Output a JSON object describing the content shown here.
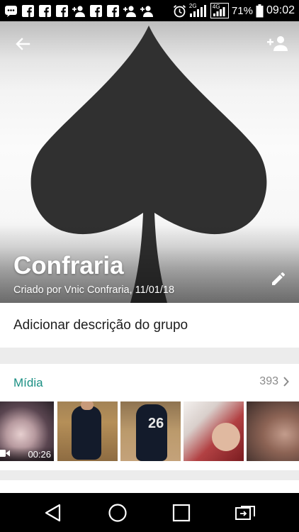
{
  "status_bar": {
    "notification_icons": [
      "whatsapp-icon",
      "facebook-icon",
      "facebook-icon",
      "facebook-icon",
      "add-contact-icon",
      "facebook-icon",
      "facebook-icon",
      "add-contact-icon",
      "add-contact-icon"
    ],
    "battery_percent": "71%",
    "time": "09:02",
    "network_labels": [
      "2G",
      "4G"
    ]
  },
  "header": {
    "group_name": "Confraria",
    "created_text": "Criado por Vnic Confraria, 11/01/18",
    "background_color": "#f4f4f4",
    "spade_color": "#303030"
  },
  "description": {
    "placeholder": "Adicionar descrição do grupo"
  },
  "media": {
    "title": "Mídia",
    "count": "393",
    "accent_color": "#1a8f83",
    "thumbnails": [
      {
        "type": "video",
        "duration": "00:26"
      },
      {
        "type": "image",
        "overlay_text": ""
      },
      {
        "type": "image",
        "overlay_text": "26"
      },
      {
        "type": "image",
        "overlay_text": ""
      },
      {
        "type": "image",
        "overlay_text": ""
      }
    ]
  },
  "nav_bar": {
    "buttons": [
      "back-icon",
      "home-icon",
      "recents-icon",
      "switch-app-icon"
    ]
  }
}
